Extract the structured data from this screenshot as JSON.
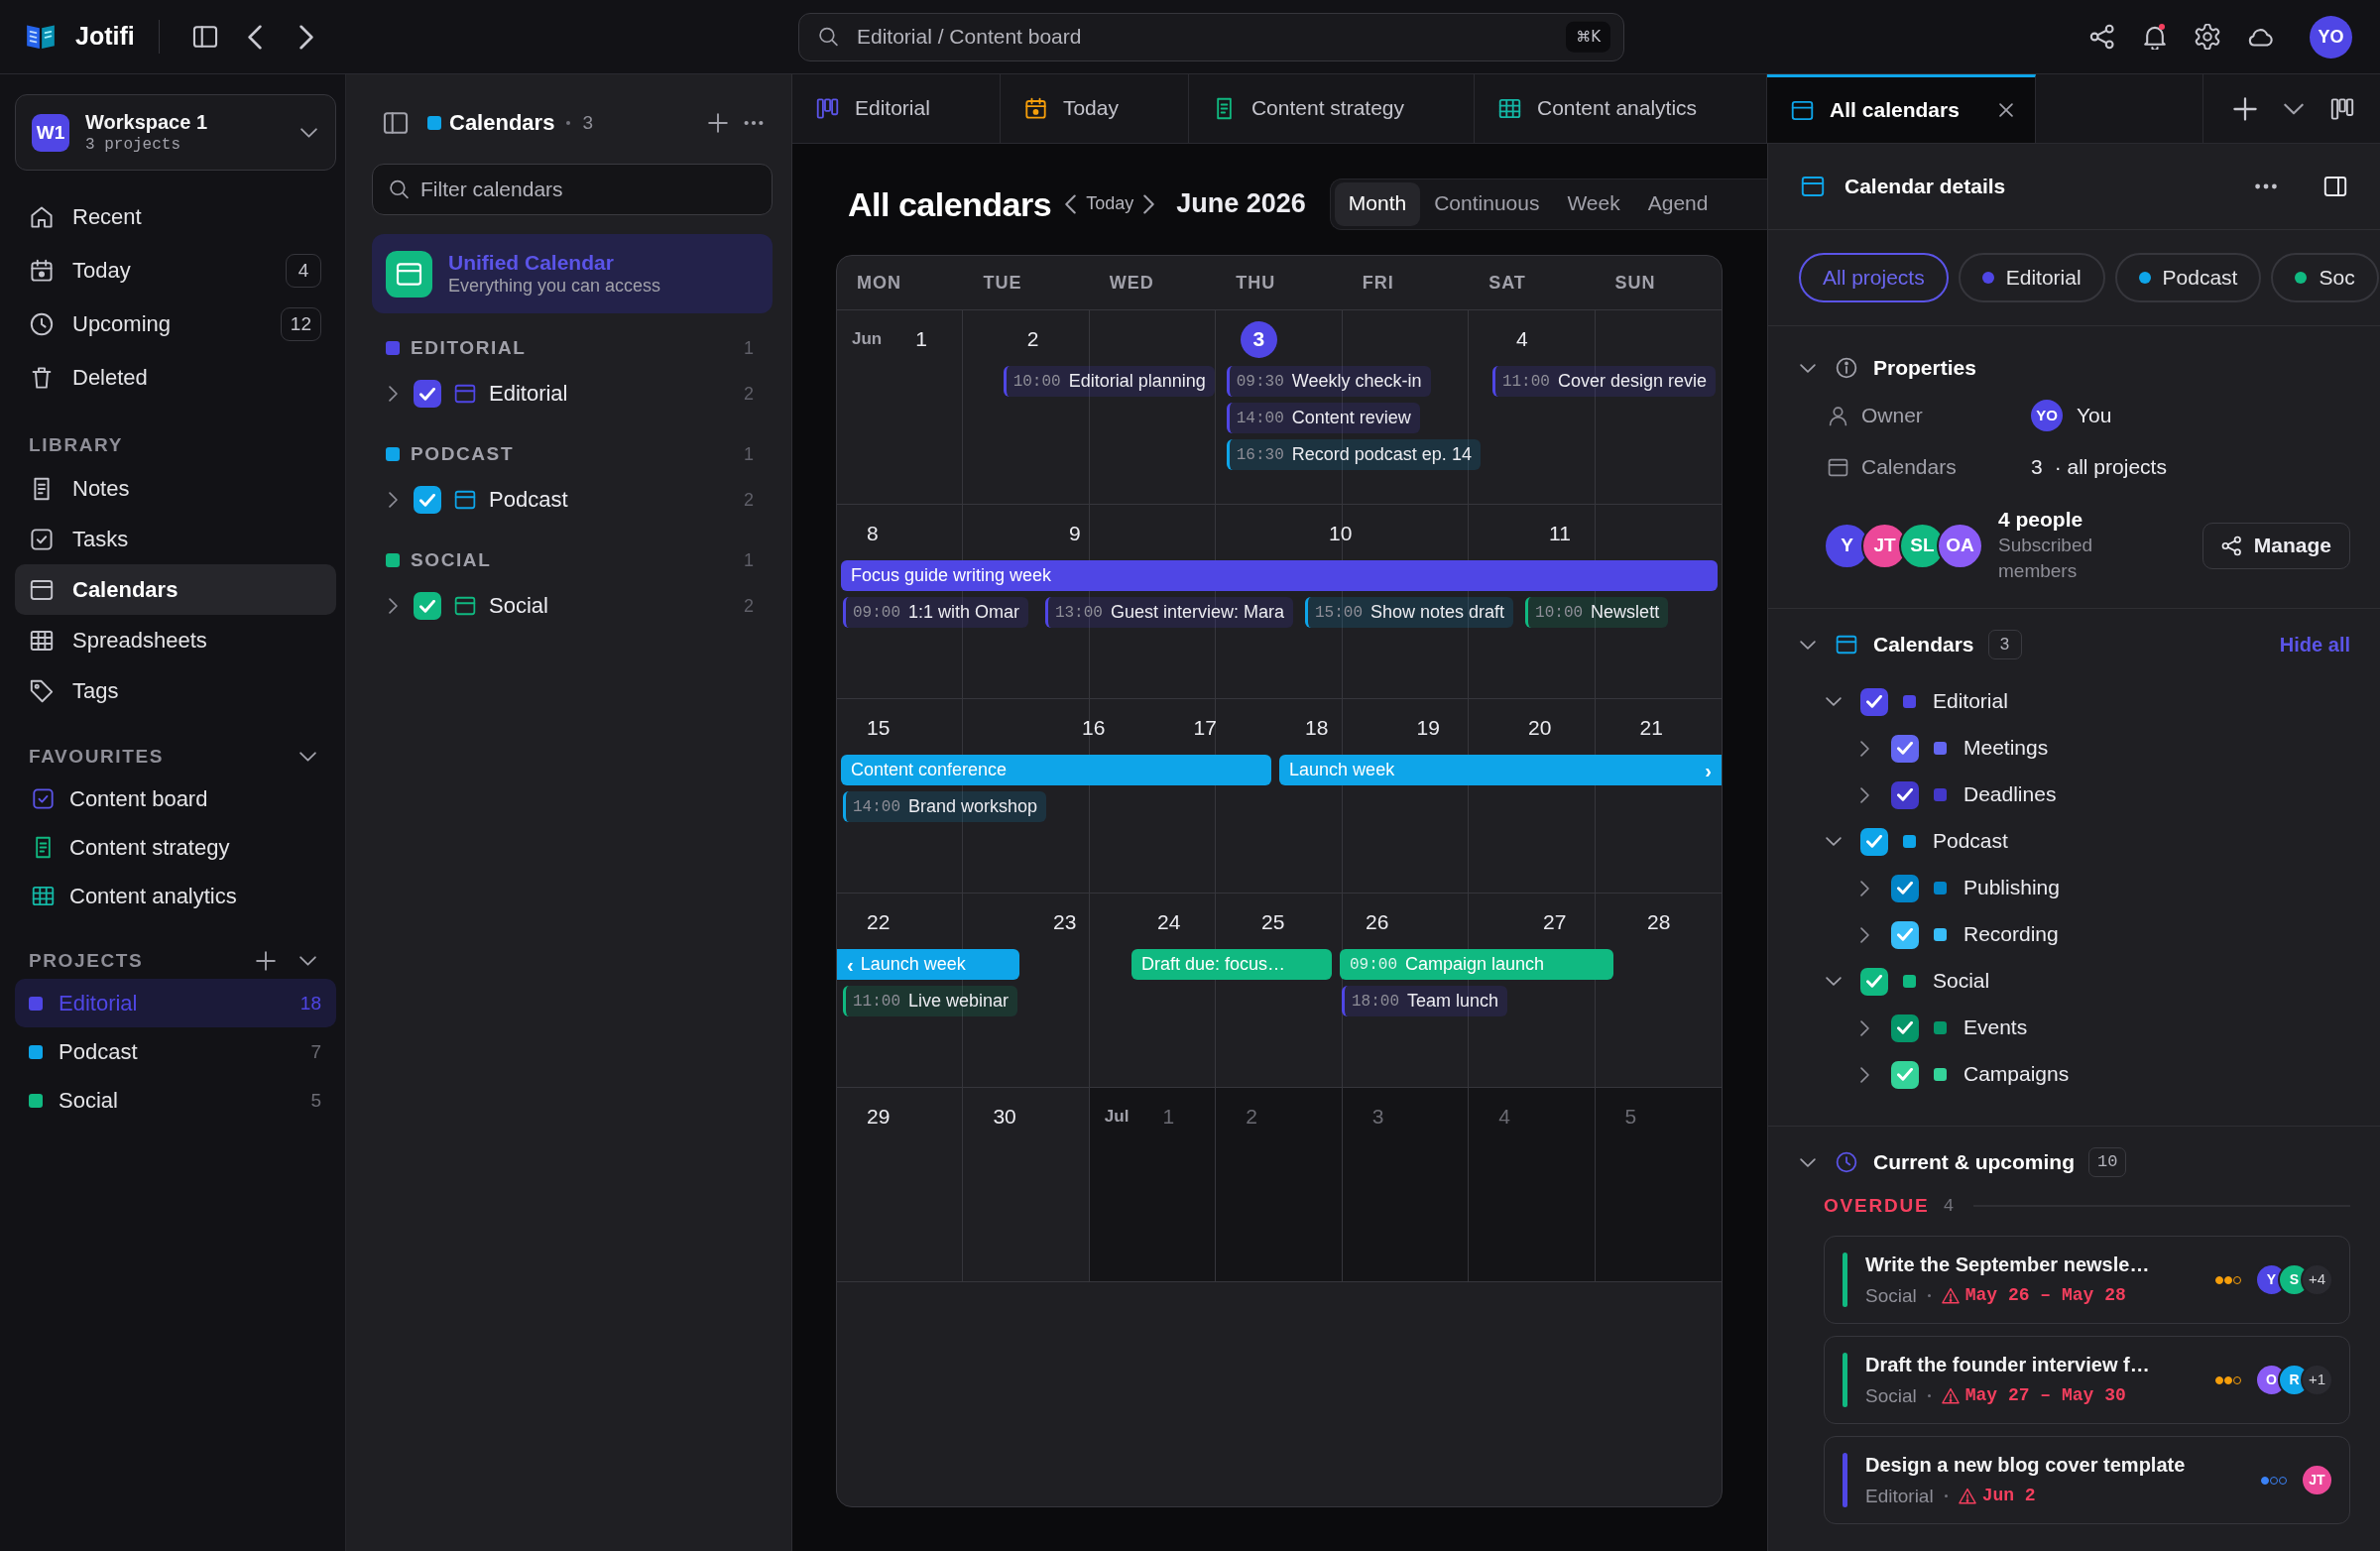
{
  "topbar": {
    "brand": "Jotifi",
    "search": {
      "placeholder": "Editorial / Content board",
      "shortcut": "⌘K"
    },
    "notifications_unread": true,
    "avatar": {
      "initials": "YO"
    }
  },
  "sidebar": {
    "workspace": {
      "badge": "W1",
      "name": "Workspace 1",
      "subtitle": "3 projects"
    },
    "nav": [
      {
        "label": "Recent",
        "selected": false
      },
      {
        "label": "Today",
        "count": "4",
        "selected": false
      },
      {
        "label": "Upcoming",
        "count": "12",
        "selected": false
      },
      {
        "label": "Deleted",
        "selected": false
      }
    ],
    "library": {
      "title": "LIBRARY",
      "items": [
        {
          "label": "Notes",
          "selected": false
        },
        {
          "label": "Tasks",
          "selected": false
        },
        {
          "label": "Calendars",
          "selected": true
        },
        {
          "label": "Spreadsheets",
          "selected": false
        },
        {
          "label": "Tags",
          "selected": false
        }
      ]
    },
    "favourites": {
      "title": "FAVOURITES",
      "items": [
        {
          "label": "Content board",
          "selected": false
        },
        {
          "label": "Content strategy",
          "selected": false
        },
        {
          "label": "Content analytics",
          "selected": false
        }
      ]
    },
    "projects": {
      "title": "PROJECTS",
      "items": [
        {
          "label": "Editorial",
          "count": "18",
          "color": "#4f46e5",
          "selected": true
        },
        {
          "label": "Podcast",
          "count": "7",
          "color": "#0ea5e9",
          "selected": false
        },
        {
          "label": "Social",
          "count": "5",
          "color": "#10b981",
          "selected": false
        }
      ]
    }
  },
  "calendars_panel": {
    "title": "Calendars",
    "count": "3",
    "filter": {
      "placeholder": "Filter calendars"
    },
    "unified": {
      "title": "Unified Calendar",
      "subtitle": "Everything you can access",
      "selected": true
    },
    "groups": [
      {
        "label": "EDITORIAL",
        "count": "1",
        "color": "#4f46e5",
        "calendars": [
          {
            "label": "Editorial",
            "count": "2",
            "color": "#4f46e5",
            "checked": true,
            "expanded": false
          }
        ]
      },
      {
        "label": "PODCAST",
        "count": "1",
        "color": "#0ea5e9",
        "calendars": [
          {
            "label": "Podcast",
            "count": "2",
            "color": "#0ea5e9",
            "checked": true,
            "expanded": false
          }
        ]
      },
      {
        "label": "SOCIAL",
        "count": "1",
        "color": "#10b981",
        "calendars": [
          {
            "label": "Social",
            "count": "2",
            "color": "#10b981",
            "checked": true,
            "expanded": false
          }
        ]
      }
    ]
  },
  "tabs": [
    {
      "label": "Editorial",
      "selected": false
    },
    {
      "label": "Today",
      "selected": false
    },
    {
      "label": "Content strategy",
      "selected": false
    },
    {
      "label": "Content analytics",
      "selected": false
    },
    {
      "label": "All calendars",
      "selected": true
    }
  ],
  "calendar": {
    "title": "All calendars",
    "today_button": "Today",
    "period": "June 2026",
    "views": [
      {
        "label": "Month",
        "selected": true
      },
      {
        "label": "Continuous",
        "selected": false
      },
      {
        "label": "Week",
        "selected": false
      },
      {
        "label": "Agend",
        "selected": false
      }
    ],
    "weekdays": [
      "MON",
      "TUE",
      "WED",
      "THU",
      "FRI",
      "SAT",
      "SUN"
    ],
    "weeks": [
      {
        "days": [
          {
            "month": "Jun",
            "day": "1",
            "today": false,
            "outside": false
          },
          {
            "day": "2",
            "today": false,
            "outside": false,
            "events": [
              {
                "time": "10:00",
                "title": "Editorial planning",
                "color": "#4f46e5"
              }
            ]
          },
          {
            "day": "3",
            "today": true,
            "outside": false,
            "events": [
              {
                "time": "09:30",
                "title": "Weekly check-in",
                "color": "#4f46e5"
              },
              {
                "time": "14:00",
                "title": "Content review",
                "color": "#4f46e5"
              },
              {
                "time": "16:30",
                "title": "Record podcast ep. 14",
                "color": "#0ea5e9"
              }
            ]
          },
          {
            "day": "4",
            "today": false,
            "outside": false,
            "events": [
              {
                "time": "11:00",
                "title": "Cover design revie",
                "color": "#4f46e5"
              }
            ]
          }
        ]
      },
      {
        "days": [
          {
            "day": "8",
            "today": false,
            "outside": false,
            "all_day": [
              {
                "kind": "event",
                "title": "Focus guide writing week",
                "color": "#4f46e5"
              }
            ],
            "events": [
              {
                "time": "09:00",
                "title": "1:1 with Omar",
                "color": "#4f46e5"
              }
            ]
          },
          {
            "day": "9",
            "today": false,
            "outside": false,
            "all_day": [
              {
                "kind": "continued"
              }
            ],
            "events": [
              {
                "time": "13:00",
                "title": "Guest interview: Mara",
                "color": "#4f46e5"
              }
            ]
          },
          {
            "day": "10",
            "today": false,
            "outside": false,
            "all_day": [
              {
                "kind": "continued"
              }
            ],
            "events": [
              {
                "time": "15:00",
                "title": "Show notes draft",
                "color": "#0ea5e9"
              }
            ]
          },
          {
            "day": "11",
            "today": false,
            "outside": false,
            "all_day": [
              {
                "kind": "continued"
              }
            ],
            "events": [
              {
                "time": "10:00",
                "title": "Newslett",
                "color": "#10b981"
              }
            ]
          }
        ]
      },
      {
        "days": [
          {
            "day": "15",
            "today": false,
            "outside": false,
            "all_day": [
              {
                "kind": "event",
                "title": "Content conference",
                "color": "#0ea5e9"
              }
            ],
            "events": [
              {
                "time": "14:00",
                "title": "Brand workshop",
                "color": "#0ea5e9"
              }
            ]
          },
          {
            "day": "16",
            "today": false,
            "outside": false,
            "all_day": [
              {
                "kind": "continued"
              }
            ]
          },
          {
            "day": "17",
            "today": false,
            "outside": false,
            "all_day": [
              {
                "kind": "continued"
              }
            ]
          },
          {
            "day": "18",
            "today": false,
            "outside": false,
            "all_day": [
              {
                "kind": "event",
                "title": "Launch week",
                "color": "#0ea5e9",
                "trail": "›"
              }
            ]
          },
          {
            "day": "19",
            "today": false,
            "outside": false,
            "all_day": [
              {
                "kind": "continued"
              }
            ]
          },
          {
            "day": "20",
            "today": false,
            "outside": false,
            "all_day": [
              {
                "kind": "continued"
              }
            ]
          },
          {
            "day": "21",
            "today": false,
            "outside": false,
            "all_day": [
              {
                "kind": "continued"
              }
            ]
          }
        ]
      },
      {
        "days": [
          {
            "day": "22",
            "today": false,
            "outside": false,
            "all_day": [
              {
                "kind": "event",
                "title": "Launch week",
                "color": "#0ea5e9",
                "lead": "‹"
              }
            ],
            "events": [
              {
                "time": "11:00",
                "title": "Live webinar",
                "color": "#10b981"
              }
            ]
          },
          {
            "day": "23",
            "today": false,
            "outside": false
          },
          {
            "day": "24",
            "today": false,
            "outside": false,
            "all_day": [
              {
                "kind": "event",
                "title": "Draft due: focus…",
                "color": "#10b981"
              }
            ]
          },
          {
            "day": "25",
            "today": false,
            "outside": false,
            "all_day": [
              {
                "kind": "continued"
              }
            ]
          },
          {
            "day": "26",
            "today": false,
            "outside": false,
            "all_day": [
              {
                "kind": "event",
                "time": "09:00",
                "title": "Campaign launch",
                "color": "#10b981"
              }
            ],
            "events": [
              {
                "time": "18:00",
                "title": "Team lunch",
                "color": "#4f46e5"
              }
            ]
          },
          {
            "day": "27",
            "today": false,
            "outside": false,
            "all_day": [
              {
                "kind": "continued"
              }
            ]
          },
          {
            "day": "28",
            "today": false,
            "outside": false
          }
        ]
      },
      {
        "days": [
          {
            "day": "29",
            "today": false,
            "outside": false
          },
          {
            "day": "30",
            "today": false,
            "outside": false
          },
          {
            "month": "Jul",
            "day": "1",
            "today": false,
            "outside": true
          },
          {
            "day": "2",
            "today": false,
            "outside": true
          },
          {
            "day": "3",
            "today": false,
            "outside": true
          },
          {
            "day": "4",
            "today": false,
            "outside": true
          },
          {
            "day": "5",
            "today": false,
            "outside": true
          }
        ]
      }
    ]
  },
  "details": {
    "title": "Calendar details",
    "filters": [
      {
        "label": "All projects",
        "selected": true
      },
      {
        "label": "Editorial",
        "color": "#4f46e5",
        "selected": false
      },
      {
        "label": "Podcast",
        "color": "#0ea5e9",
        "selected": false
      },
      {
        "label": "Soc",
        "color": "#10b981",
        "selected": false
      }
    ],
    "properties": {
      "title": "Properties",
      "owner": {
        "label": "Owner",
        "initials": "YO",
        "value": "You"
      },
      "calendars": {
        "label": "Calendars",
        "value": "3",
        "note": "· all projects"
      },
      "members": {
        "avatars": [
          {
            "initials": "Y",
            "color": "#4f46e5"
          },
          {
            "initials": "JT",
            "color": "#ec4899"
          },
          {
            "initials": "SL",
            "color": "#10b981"
          },
          {
            "initials": "OA",
            "color": "#8b5cf6"
          }
        ],
        "title": "4 people",
        "subtitle": "Subscribed members",
        "action": "Manage"
      }
    },
    "calendars": {
      "title": "Calendars",
      "count": "3",
      "action": "Hide all",
      "tree": [
        {
          "label": "Editorial",
          "color": "#4f46e5",
          "checked": true,
          "expanded": true,
          "children": [
            {
              "label": "Meetings",
              "color": "#6366f1",
              "checked": true,
              "expanded": false
            },
            {
              "label": "Deadlines",
              "color": "#4338ca",
              "checked": true,
              "expanded": false
            }
          ]
        },
        {
          "label": "Podcast",
          "color": "#0ea5e9",
          "checked": true,
          "expanded": true,
          "children": [
            {
              "label": "Publishing",
              "color": "#0284c7",
              "checked": true,
              "expanded": false
            },
            {
              "label": "Recording",
              "color": "#38bdf8",
              "checked": true,
              "expanded": false
            }
          ]
        },
        {
          "label": "Social",
          "color": "#10b981",
          "checked": true,
          "expanded": true,
          "children": [
            {
              "label": "Events",
              "color": "#059669",
              "checked": true,
              "expanded": false
            },
            {
              "label": "Campaigns",
              "color": "#34d399",
              "checked": true,
              "expanded": false
            }
          ]
        }
      ]
    },
    "upcoming": {
      "title": "Current & upcoming",
      "count": "10",
      "groups": [
        {
          "label": "OVERDUE",
          "count": "4",
          "tasks": [
            {
              "title": "Write the September newsle…",
              "project": "Social",
              "color": "#10b981",
              "due": "May 26 – May 28",
              "meter": {
                "stars": 2,
                "color": "#f59e0b"
              },
              "assignees": [
                {
                  "initials": "Y",
                  "color": "#4f46e5"
                },
                {
                  "initials": "S",
                  "color": "#10b981"
                }
              ],
              "more": "+4"
            },
            {
              "title": "Draft the founder interview f…",
              "project": "Social",
              "color": "#10b981",
              "due": "May 27 – May 30",
              "meter": {
                "stars": 2,
                "color": "#f59e0b"
              },
              "assignees": [
                {
                  "initials": "O",
                  "color": "#8b5cf6"
                },
                {
                  "initials": "R",
                  "color": "#0ea5e9"
                }
              ],
              "more": "+1"
            },
            {
              "title": "Design a new blog cover template",
              "project": "Editorial",
              "color": "#4f46e5",
              "due": "Jun 2",
              "meter": {
                "stars": 1,
                "color": "#3b82f6"
              },
              "assignees": [
                {
                  "initials": "JT",
                  "color": "#ec4899"
                }
              ]
            }
          ]
        }
      ]
    }
  }
}
